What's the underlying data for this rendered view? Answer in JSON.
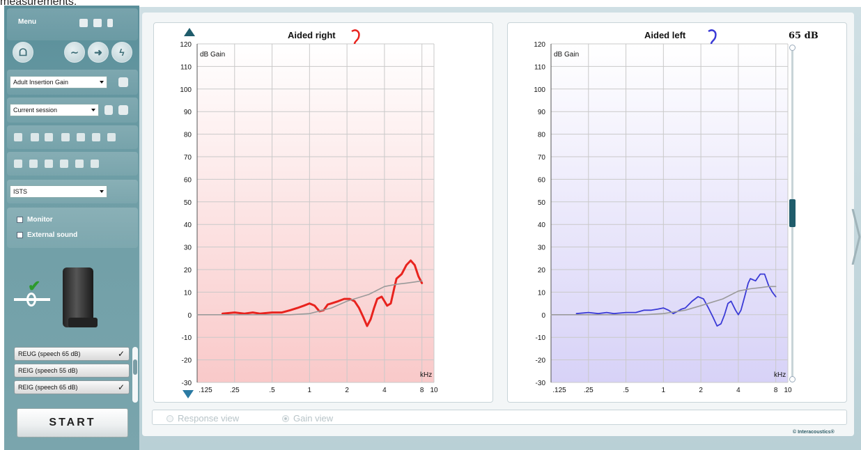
{
  "page_top_text": "measurements.",
  "sidebar": {
    "menu_label": "Menu",
    "protocol_dropdown": "Adult Insertion Gain",
    "session_dropdown": "Current session",
    "stimulus_dropdown": "ISTS",
    "monitor_label": "Monitor",
    "external_sound_label": "External sound",
    "measurements": [
      {
        "label": "REUG (speech 65 dB)",
        "checked": true
      },
      {
        "label": "REIG (speech 55 dB)",
        "checked": false
      },
      {
        "label": "REIG (speech 65 dB)",
        "checked": true
      }
    ],
    "tick_glyph": "✓",
    "start_label": "START"
  },
  "level_label": "65 dB",
  "views": {
    "response_view": "Response view",
    "gain_view": "Gain view",
    "selected": "gain_view"
  },
  "copyright": "© Interacoustics®",
  "colors": {
    "right_curve": "#e8231e",
    "left_curve": "#3a3ad6",
    "target_curve": "#9a9a9a",
    "right_fill_top": "#ffffff",
    "right_fill_bottom": "#f9c9c9",
    "left_fill_bottom": "#d7d2f7",
    "accent": "#1f5c6b"
  },
  "chart_data": [
    {
      "type": "line",
      "title": "Aided right",
      "ylabel": "dB Gain",
      "xlabel": "kHz",
      "ylim": [
        -30,
        120
      ],
      "y_ticks": [
        120,
        110,
        100,
        90,
        80,
        70,
        60,
        50,
        40,
        30,
        20,
        10,
        0,
        -10,
        -20,
        -30
      ],
      "x_scale": "log",
      "x_ticks": [
        ".125",
        ".25",
        ".5",
        "1",
        "2",
        "4",
        "8",
        "10"
      ],
      "x_tick_values": [
        0.125,
        0.25,
        0.5,
        1,
        2,
        4,
        8,
        10
      ],
      "series": [
        {
          "role": "measured",
          "x": [
            0.2,
            0.25,
            0.3,
            0.35,
            0.4,
            0.5,
            0.6,
            0.7,
            0.8,
            0.9,
            1.0,
            1.1,
            1.2,
            1.3,
            1.4,
            1.5,
            1.7,
            1.9,
            2.1,
            2.3,
            2.5,
            2.7,
            2.9,
            3.1,
            3.3,
            3.5,
            3.8,
            4.0,
            4.2,
            4.5,
            4.8,
            5.0,
            5.5,
            6.0,
            6.5,
            7.0,
            7.5,
            8.0
          ],
          "y": [
            0.5,
            1,
            0.5,
            1,
            0.5,
            1,
            1,
            2,
            3,
            4,
            5,
            4,
            1.5,
            2,
            4.5,
            5,
            6,
            7,
            7,
            6,
            3,
            -1,
            -5,
            -2,
            3,
            7,
            8,
            6,
            4,
            5,
            12,
            16,
            18,
            22,
            24,
            22,
            17,
            14
          ]
        },
        {
          "role": "target",
          "x": [
            0.125,
            0.5,
            0.7,
            1.0,
            1.5,
            2.0,
            3.0,
            4.0,
            5.0,
            6.0,
            7.0,
            8.0
          ],
          "y": [
            0,
            0,
            0,
            0.5,
            3,
            6,
            9,
            12.5,
            13.5,
            14,
            14.5,
            15
          ]
        }
      ]
    },
    {
      "type": "line",
      "title": "Aided left",
      "ylabel": "dB Gain",
      "xlabel": "kHz",
      "ylim": [
        -30,
        120
      ],
      "y_ticks": [
        120,
        110,
        100,
        90,
        80,
        70,
        60,
        50,
        40,
        30,
        20,
        10,
        0,
        -10,
        -20,
        -30
      ],
      "x_scale": "log",
      "x_ticks": [
        ".125",
        ".25",
        ".5",
        "1",
        "2",
        "4",
        "8",
        "10"
      ],
      "x_tick_values": [
        0.125,
        0.25,
        0.5,
        1,
        2,
        4,
        8,
        10
      ],
      "series": [
        {
          "role": "measured",
          "x": [
            0.2,
            0.25,
            0.3,
            0.35,
            0.4,
            0.5,
            0.6,
            0.7,
            0.8,
            0.9,
            1.0,
            1.1,
            1.2,
            1.3,
            1.4,
            1.5,
            1.7,
            1.9,
            2.1,
            2.3,
            2.5,
            2.7,
            2.9,
            3.1,
            3.3,
            3.5,
            3.8,
            4.0,
            4.2,
            4.5,
            4.8,
            5.0,
            5.5,
            6.0,
            6.5,
            7.0,
            7.5,
            8.0
          ],
          "y": [
            0.5,
            1,
            0.5,
            1,
            0.5,
            1,
            1,
            2,
            2,
            2.5,
            3,
            2,
            0.5,
            1.5,
            2.5,
            3,
            6,
            8,
            7,
            3,
            -1,
            -5,
            -4,
            0,
            5,
            6,
            2,
            0,
            2,
            8,
            14,
            16,
            15,
            18,
            18,
            13,
            10,
            8
          ]
        },
        {
          "role": "target",
          "x": [
            0.125,
            0.5,
            0.7,
            1.0,
            1.5,
            2.0,
            3.0,
            4.0,
            5.0,
            6.0,
            7.0,
            8.0
          ],
          "y": [
            0,
            0,
            0,
            0.5,
            2,
            4,
            7,
            10.5,
            11.5,
            12,
            12.5,
            12.5
          ]
        }
      ]
    }
  ]
}
